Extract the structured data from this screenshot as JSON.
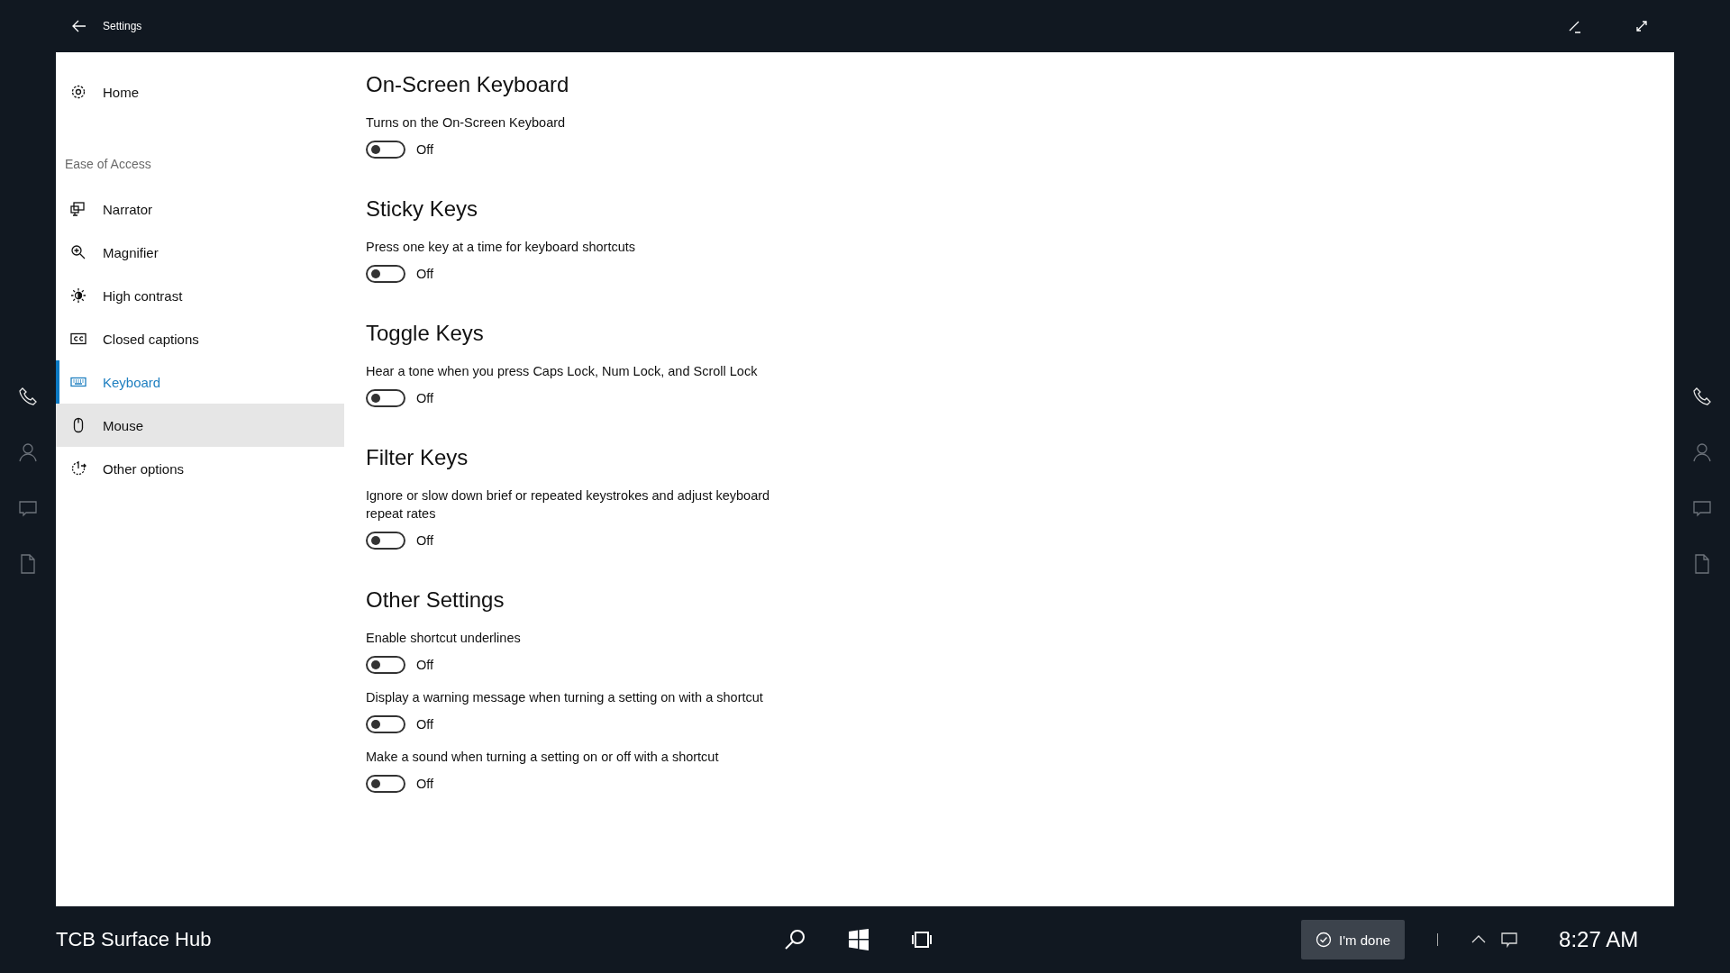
{
  "title_bar": {
    "title": "Settings"
  },
  "sidebar": {
    "home": "Home",
    "group_label": "Ease of Access",
    "items": [
      {
        "label": "Narrator",
        "selected": false,
        "hovered": false
      },
      {
        "label": "Magnifier",
        "selected": false,
        "hovered": false
      },
      {
        "label": "High contrast",
        "selected": false,
        "hovered": false
      },
      {
        "label": "Closed captions",
        "selected": false,
        "hovered": false
      },
      {
        "label": "Keyboard",
        "selected": true,
        "hovered": false
      },
      {
        "label": "Mouse",
        "selected": false,
        "hovered": true
      },
      {
        "label": "Other options",
        "selected": false,
        "hovered": false
      }
    ]
  },
  "sections": [
    {
      "title": "On-Screen Keyboard",
      "settings": [
        {
          "description": "Turns on the On-Screen Keyboard",
          "on": false,
          "state_label": "Off"
        }
      ]
    },
    {
      "title": "Sticky Keys",
      "settings": [
        {
          "description": "Press one key at a time for keyboard shortcuts",
          "on": false,
          "state_label": "Off"
        }
      ]
    },
    {
      "title": "Toggle Keys",
      "settings": [
        {
          "description": "Hear a tone when you press Caps Lock, Num Lock, and Scroll Lock",
          "on": false,
          "state_label": "Off"
        }
      ]
    },
    {
      "title": "Filter Keys",
      "settings": [
        {
          "description": "Ignore or slow down brief or repeated keystrokes and adjust keyboard repeat rates",
          "on": false,
          "state_label": "Off"
        }
      ]
    },
    {
      "title": "Other Settings",
      "settings": [
        {
          "description": "Enable shortcut underlines",
          "on": false,
          "state_label": "Off"
        },
        {
          "description": "Display a warning message when turning a setting on with a shortcut",
          "on": false,
          "state_label": "Off"
        },
        {
          "description": "Make a sound when turning a setting on or off with a shortcut",
          "on": false,
          "state_label": "Off"
        }
      ]
    }
  ],
  "taskbar": {
    "device_name": "TCB Surface Hub",
    "done_button": "I'm done",
    "time": "8:27 AM"
  }
}
